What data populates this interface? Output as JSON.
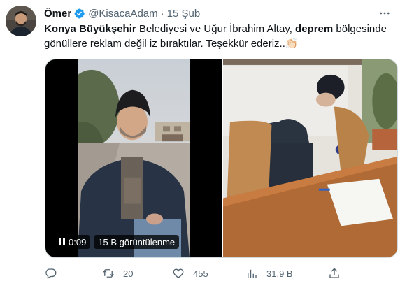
{
  "tweet": {
    "author_name": "Ömer",
    "handle": "@KisacaAdam",
    "separator": "·",
    "date": "15 Şub",
    "more_icon": "more-horizontal-icon",
    "text": {
      "part1_bold": "Konya Büyükşehir",
      "part2": " Belediyesi ve Uğur İbrahim Altay, ",
      "part3_bold": "deprem",
      "part4": " bölgesinde gönüllere reklam değil iz bıraktılar. Teşekkür ederiz..",
      "emoji": "👏🏻"
    },
    "video": {
      "time": "0:09",
      "views": "15 B görüntülenme"
    },
    "actions": {
      "reply_count": "",
      "retweet_count": "20",
      "like_count": "455",
      "views_count": "31,9 B"
    },
    "colors": {
      "verified": "#1d9bf0",
      "secondary_text": "#536471",
      "border": "#cfd9de"
    }
  }
}
